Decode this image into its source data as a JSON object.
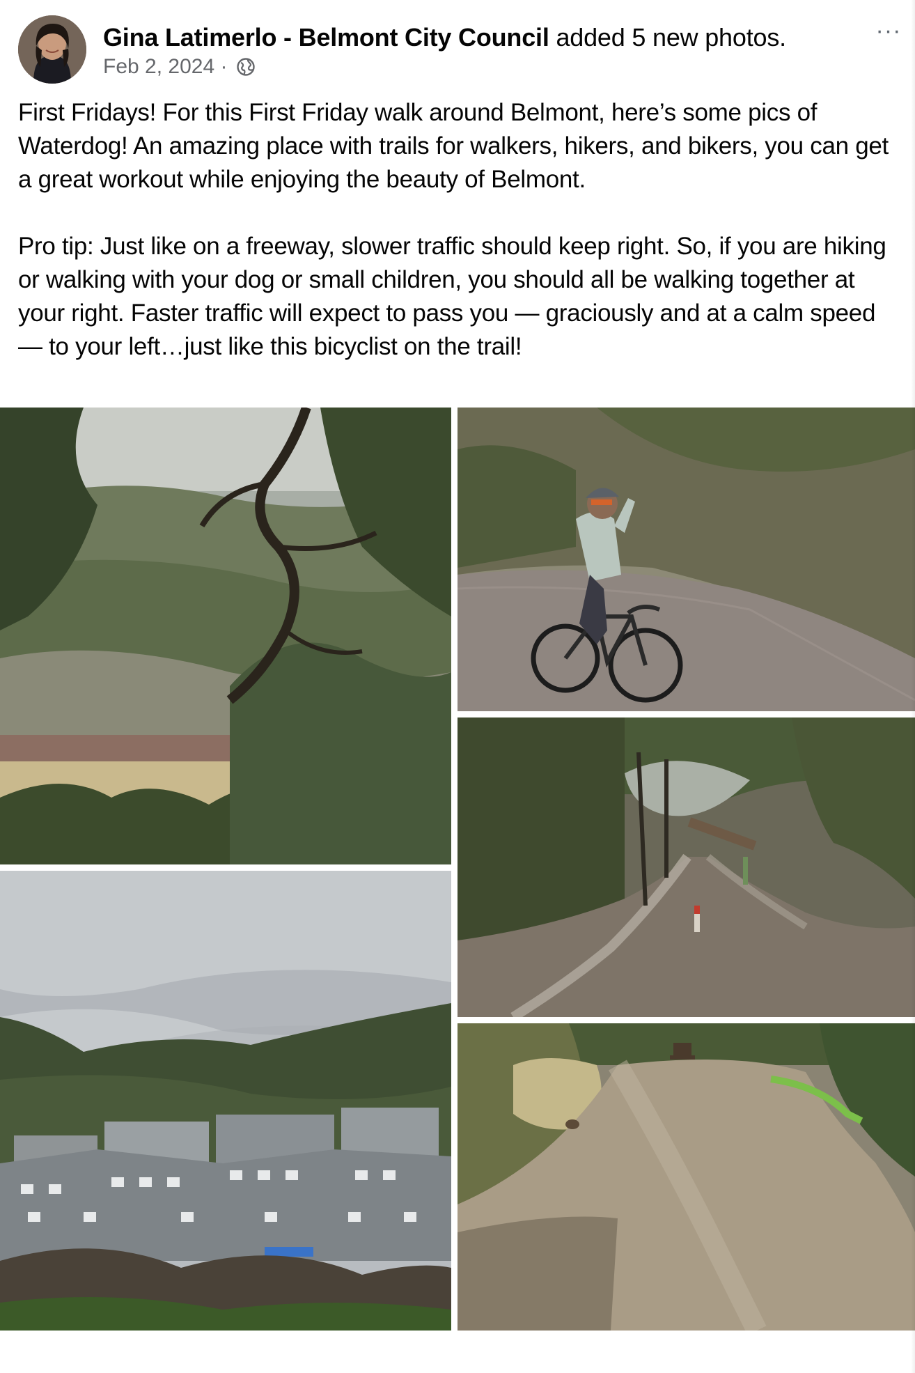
{
  "post": {
    "author": {
      "name": "Gina Latimerlo - Belmont City Council",
      "action": " added 5 new photos.",
      "avatar_icon": "profile-photo"
    },
    "meta": {
      "date": "Feb 2, 2024",
      "separator": " · ",
      "privacy_icon": "globe-icon"
    },
    "more_label": "···",
    "text": {
      "paragraph_1": "First Fridays! For this First Friday walk around Belmont, here’s some pics of Waterdog! An amazing place with trails for walkers, hikers, and bikers, you can get a great workout while enjoying the beauty of Belmont.",
      "paragraph_2": "Pro tip: Just like on a freeway, slower traffic should keep right. So, if you are hiking or walking with your dog or small children, you should all be walking together at your right. Faster traffic will expect to pass you — graciously and at a calm speed — to your left…just like this bicyclist on the trail!"
    },
    "photos": [
      {
        "subject": "oak branches over lake"
      },
      {
        "subject": "bicyclist on trail"
      },
      {
        "subject": "housing and hills"
      },
      {
        "subject": "forked dirt trail"
      },
      {
        "subject": "gravel path with bench"
      }
    ]
  },
  "colors": {
    "text_primary": "#050505",
    "text_secondary": "#65676b",
    "background": "#ffffff"
  }
}
